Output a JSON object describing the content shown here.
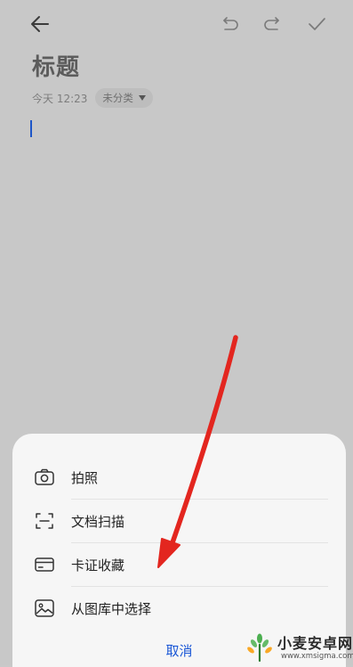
{
  "note": {
    "title": "标题",
    "time": "今天 12:23",
    "category": "未分类"
  },
  "toolbar": {
    "icons": [
      "back-arrow-icon",
      "undo-icon",
      "redo-icon",
      "check-icon"
    ]
  },
  "sheet": {
    "items": [
      {
        "label": "拍照",
        "icon": "camera-icon"
      },
      {
        "label": "文档扫描",
        "icon": "scan-icon"
      },
      {
        "label": "卡证收藏",
        "icon": "card-icon"
      },
      {
        "label": "从图库中选择",
        "icon": "gallery-icon"
      }
    ],
    "cancel_label": "取消"
  },
  "watermark": {
    "name": "小麦安卓网",
    "url": "www.xmsigma.com"
  },
  "colors": {
    "accent": "#1a57d6",
    "annotation_arrow": "#e3261f",
    "dimmed_background": "#c8c8c8"
  }
}
